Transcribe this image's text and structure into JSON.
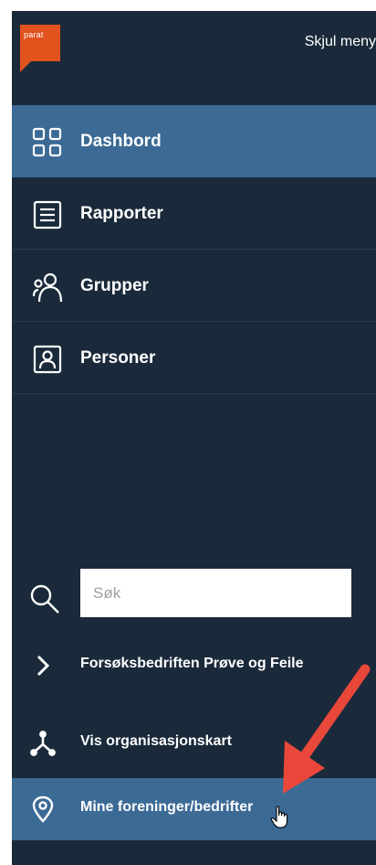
{
  "header": {
    "logo_text": "parat",
    "hide_menu_label": "Skjul meny"
  },
  "nav": {
    "items": [
      {
        "label": "Dashbord",
        "icon": "grid-icon",
        "active": true
      },
      {
        "label": "Rapporter",
        "icon": "document-icon",
        "active": false
      },
      {
        "label": "Grupper",
        "icon": "group-icon",
        "active": false
      },
      {
        "label": "Personer",
        "icon": "person-card-icon",
        "active": false
      }
    ]
  },
  "search": {
    "placeholder": "Søk",
    "icon": "search-icon"
  },
  "links": {
    "items": [
      {
        "label": "Forsøksbedriften Prøve og Feile",
        "icon": "chevron-right-icon",
        "active": false
      },
      {
        "label": "Vis organisasjonskart",
        "icon": "org-chart-icon",
        "active": false
      },
      {
        "label": "Mine foreninger/bedrifter",
        "icon": "location-pin-icon",
        "active": true
      }
    ]
  },
  "colors": {
    "sidebar_bg": "#1a2a3a",
    "active_bg": "#3b6a95",
    "logo_orange": "#e2531e",
    "annotation_arrow": "#e8473a"
  }
}
